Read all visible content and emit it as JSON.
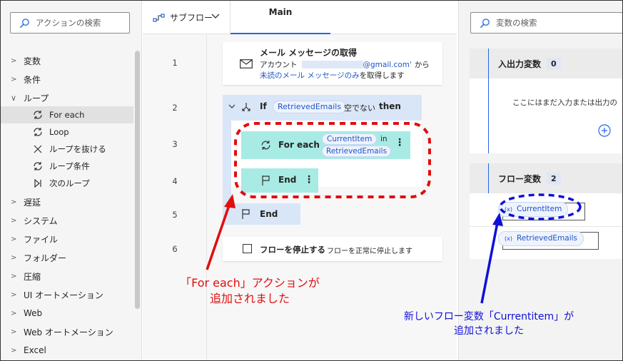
{
  "actions_panel": {
    "search_placeholder": "アクションの検索",
    "categories_top": [
      {
        "label": "変数",
        "expanded": false
      },
      {
        "label": "条件",
        "expanded": false
      },
      {
        "label": "ループ",
        "expanded": true
      }
    ],
    "loop_items": [
      {
        "label": "For each",
        "icon": "loop-icon",
        "selected": true
      },
      {
        "label": "Loop",
        "icon": "loop-icon",
        "selected": false
      },
      {
        "label": "ループを抜ける",
        "icon": "close-icon",
        "selected": false
      },
      {
        "label": "ループ条件",
        "icon": "loop-icon",
        "selected": false
      },
      {
        "label": "次のループ",
        "icon": "next-loop-icon",
        "selected": false
      }
    ],
    "categories_bottom": [
      "遅延",
      "システム",
      "ファイル",
      "フォルダー",
      "圧縮",
      "UI オートメーション",
      "Web",
      "Web オートメーション",
      "Excel"
    ]
  },
  "designer": {
    "subflow_label": "サブフロー",
    "main_tab": "Main",
    "line_numbers": [
      "1",
      "2",
      "3",
      "4",
      "5",
      "6"
    ],
    "step1": {
      "title": "メール メッセージの取得",
      "account_prefix": "アカウント",
      "account_suffix": "@gmail.com'",
      "from": "から",
      "unread": "未読のメール メッセージのみ",
      "retrieve": "を取得します"
    },
    "step2": {
      "keyword": "If",
      "variable": "RetrievedEmails",
      "condition": "空でない",
      "then": "then"
    },
    "step3": {
      "keyword": "For each",
      "item": "CurrentItem",
      "in": "in",
      "collection": "RetrievedEmails"
    },
    "step4": {
      "keyword": "End"
    },
    "step5": {
      "keyword": "End"
    },
    "step6": {
      "title": "フローを停止する",
      "desc": "フローを正常に停止します"
    }
  },
  "variables_panel": {
    "search_placeholder": "変数の検索",
    "io_section": {
      "title": "入出力変数",
      "count": "0",
      "empty_text": "ここにはまだ入力または出力の"
    },
    "flow_section": {
      "title": "フロー変数",
      "count": "2",
      "vars": [
        "CurrentItem",
        "RetrievedEmails"
      ]
    }
  },
  "annotations": {
    "red_line1": "「For each」アクションが",
    "red_line2": "追加されました",
    "blue_line1": "新しいフロー変数「Currentitem」が",
    "blue_line2": "追加されました"
  },
  "colors": {
    "accent": "#2266e3",
    "selected_block": "#a8ebe4",
    "red_annotation": "#e10e0e",
    "blue_annotation": "#1010d8"
  }
}
